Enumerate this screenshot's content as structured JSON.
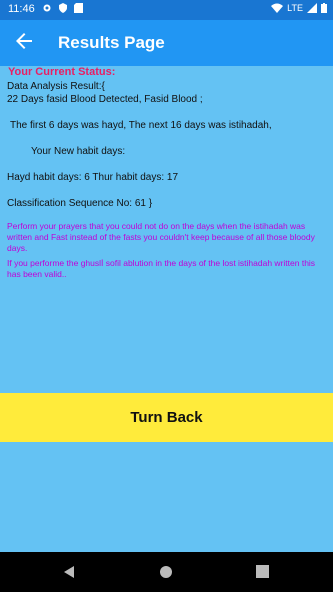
{
  "status_bar": {
    "time": "11:46",
    "network": "LTE"
  },
  "app_bar": {
    "title": "Results Page",
    "back_icon": "arrow-back-icon"
  },
  "result": {
    "status_heading": "Your Current Status:",
    "analysis_label": "Data Analysis Result:{",
    "line1": "22 Days fasid Blood Detected,  Fasid  Blood ;",
    "line2": "The first 6 days was hayd, The next 16 days was istihadah,",
    "line3": "Your New habit days:",
    "line4": "Hayd habit days: 6 Thur habit days: 17",
    "line5": "Classification Sequence No: 61 }",
    "note1": "Perform your prayers that you could not do on the days when the istihadah was written and Fast instead of the fasts you couldn't keep because of all those bloody days.",
    "note2": "If you performe the ghuslİ sofil ablution in the days of the lost istihadah written this has been valid.."
  },
  "button": {
    "turn_back": "Turn Back"
  },
  "colors": {
    "background": "#64c2f3",
    "app_bar": "#2196f3",
    "button": "#ffeb3b",
    "heading": "#e91e63",
    "note": "#c000d8"
  }
}
